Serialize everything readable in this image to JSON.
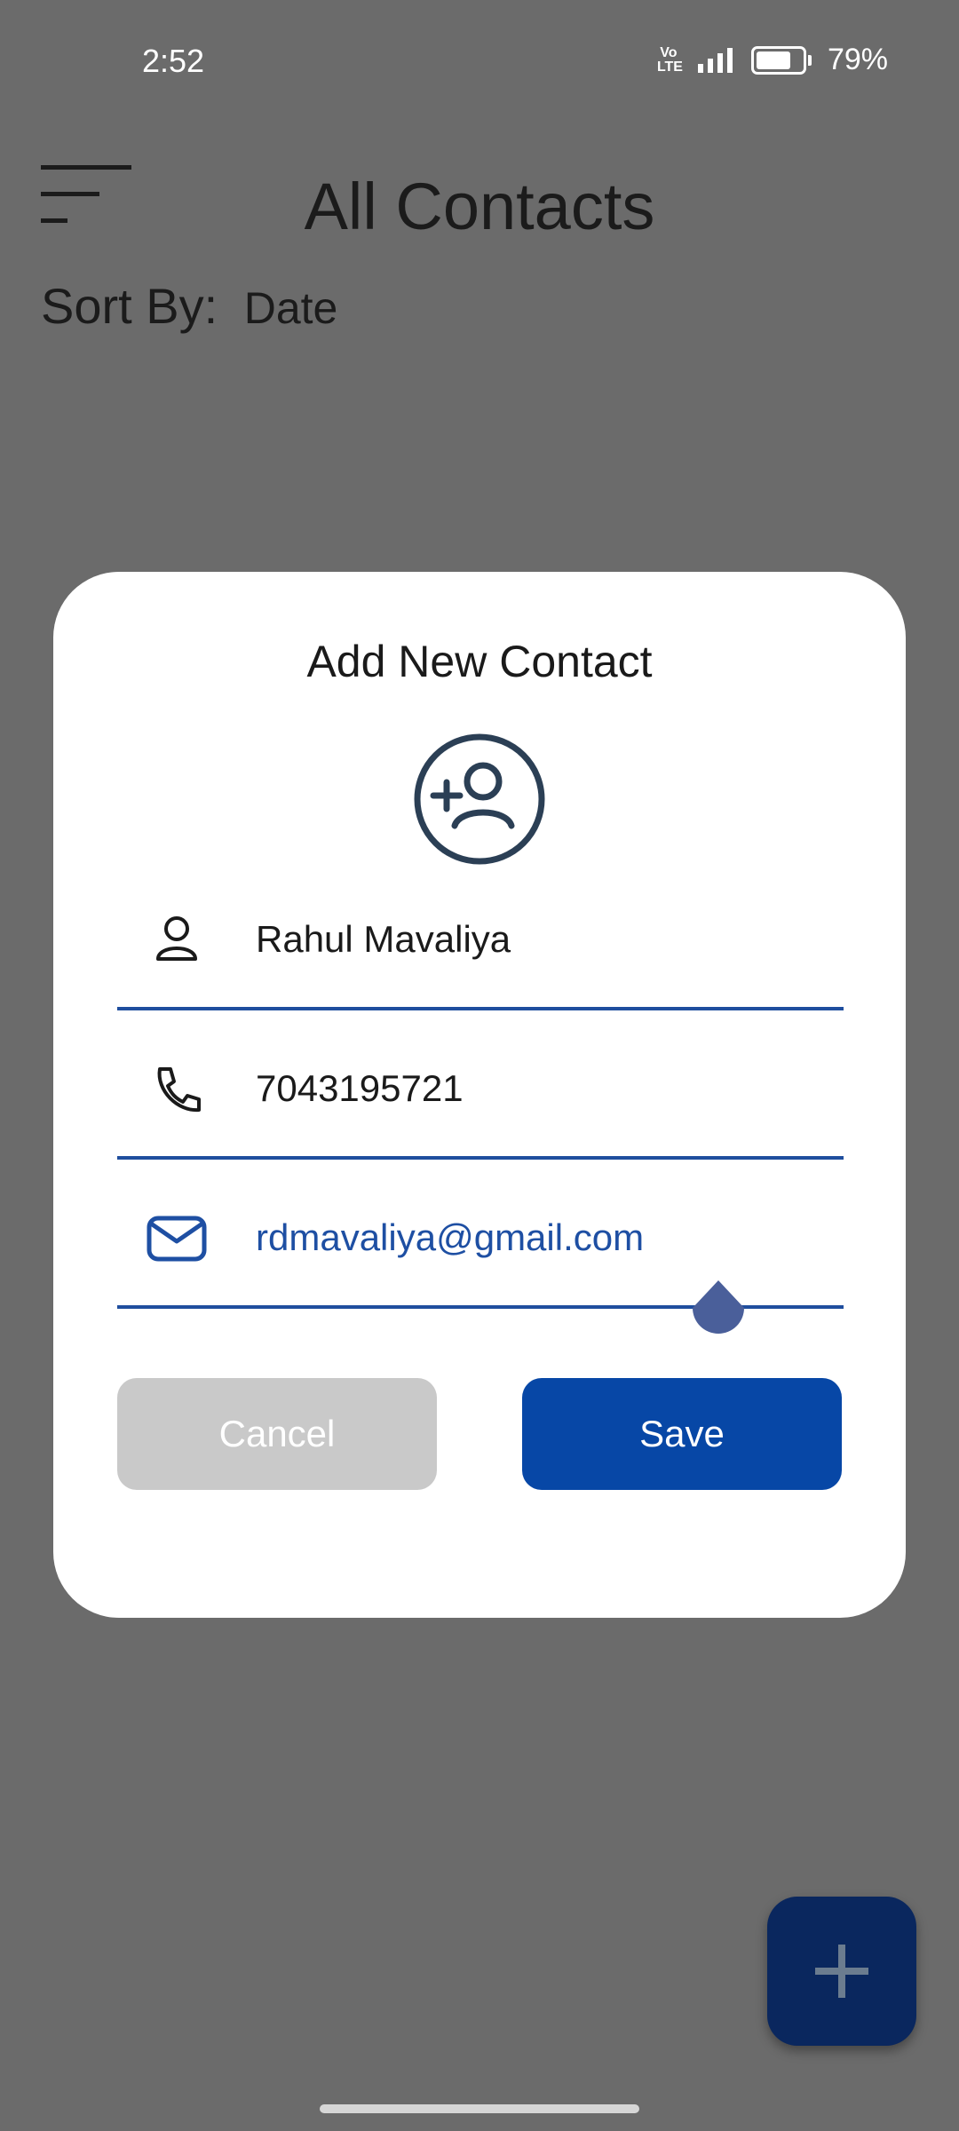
{
  "status_bar": {
    "time": "2:52",
    "volte_top": "Vo",
    "volte_bottom": "LTE",
    "battery_percent": "79%",
    "battery_level": 0.79
  },
  "header": {
    "title": "All Contacts",
    "menu_icon": "sort-lines-icon"
  },
  "sort": {
    "label": "Sort By:",
    "value": "Date"
  },
  "dialog": {
    "title": "Add New Contact",
    "avatar_icon": "add-person-icon",
    "fields": {
      "name": {
        "icon": "person-icon",
        "value": "Rahul Mavaliya"
      },
      "phone": {
        "icon": "phone-icon",
        "value": "7043195721"
      },
      "email": {
        "icon": "mail-icon",
        "value": "rdmavaliya@gmail.com"
      }
    },
    "cancel_label": "Cancel",
    "save_label": "Save"
  },
  "fab": {
    "icon": "plus-icon"
  },
  "colors": {
    "scrim_background": "#6b6b6b",
    "accent": "#0747a6",
    "field_underline": "#1f4e9e",
    "cancel_button": "#c9c9c9",
    "fab": "#0a275e"
  }
}
